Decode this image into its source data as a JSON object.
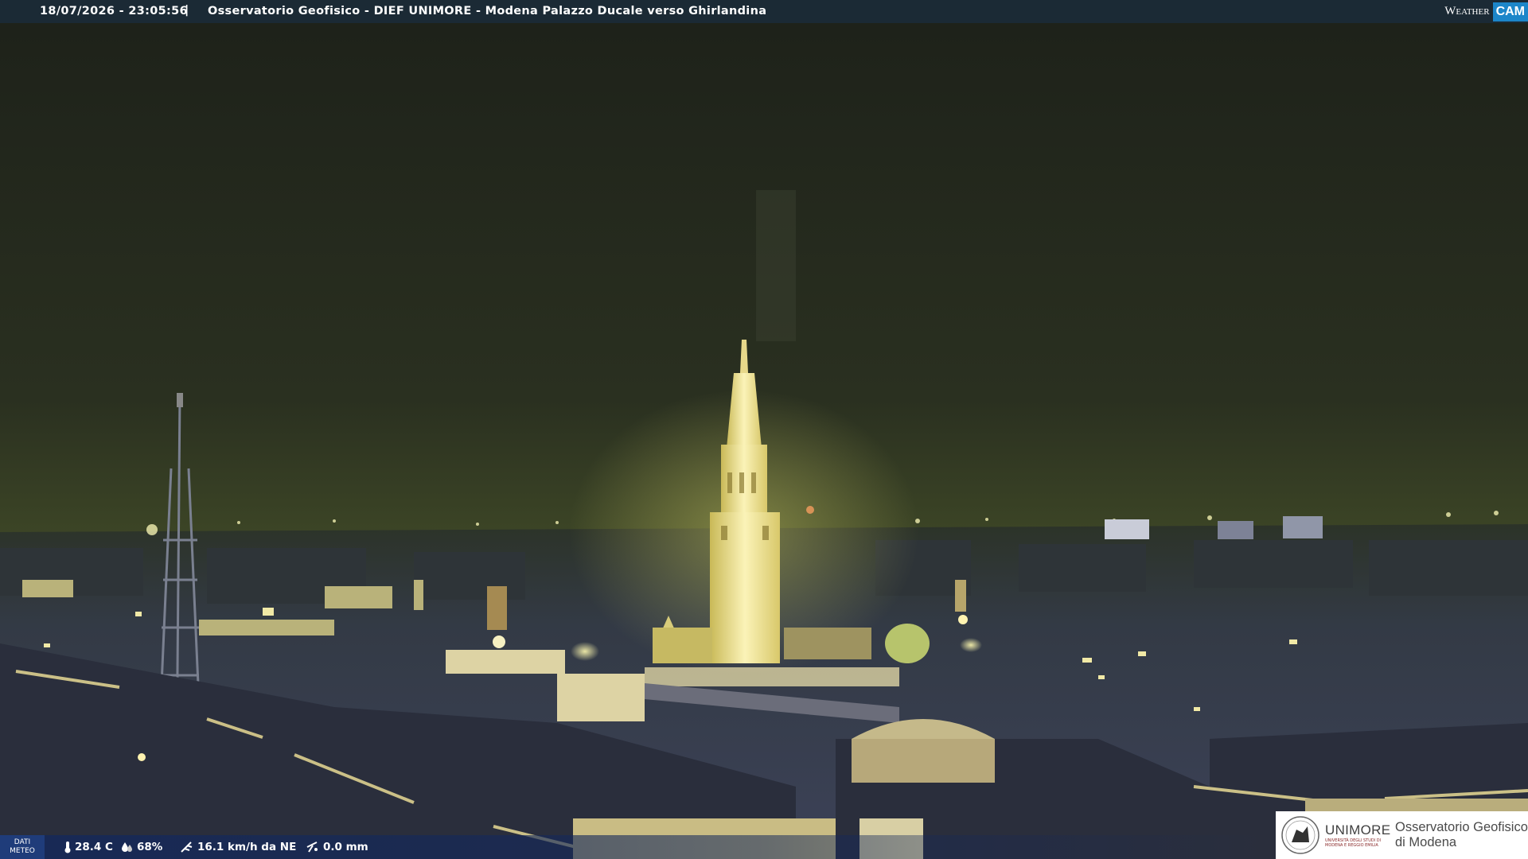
{
  "header": {
    "timestamp": "18/07/2026 - 23:05:56",
    "separator": "|",
    "title": "Osservatorio Geofisico - DIEF UNIMORE - Modena Palazzo Ducale verso Ghirlandina",
    "brand_weather": "Weather",
    "brand_cam": "CAM"
  },
  "meteo": {
    "tag_line1": "DATI",
    "tag_line2": "METEO",
    "temperature": "28.4 C",
    "humidity": "68%",
    "wind": "16.1 km/h da NE",
    "rain": "0.0 mm"
  },
  "logo": {
    "university": "UNIMORE",
    "university_sub": "UNIVERSITÀ DEGLI STUDI DI MODENA E REGGIO EMILIA",
    "observatory_line1": "Osservatorio Geofisico",
    "observatory_line2": "di Modena"
  },
  "colors": {
    "topbar": "#1b2a35",
    "sky": "#1f241c",
    "horizon_glow": "#5d6a2c",
    "tower_light": "#f3e9a0",
    "brand_blue": "#1c86c9"
  },
  "icons": [
    "thermometer-icon",
    "humidity-drop-icon",
    "wind-icon",
    "rain-gauge-icon"
  ]
}
